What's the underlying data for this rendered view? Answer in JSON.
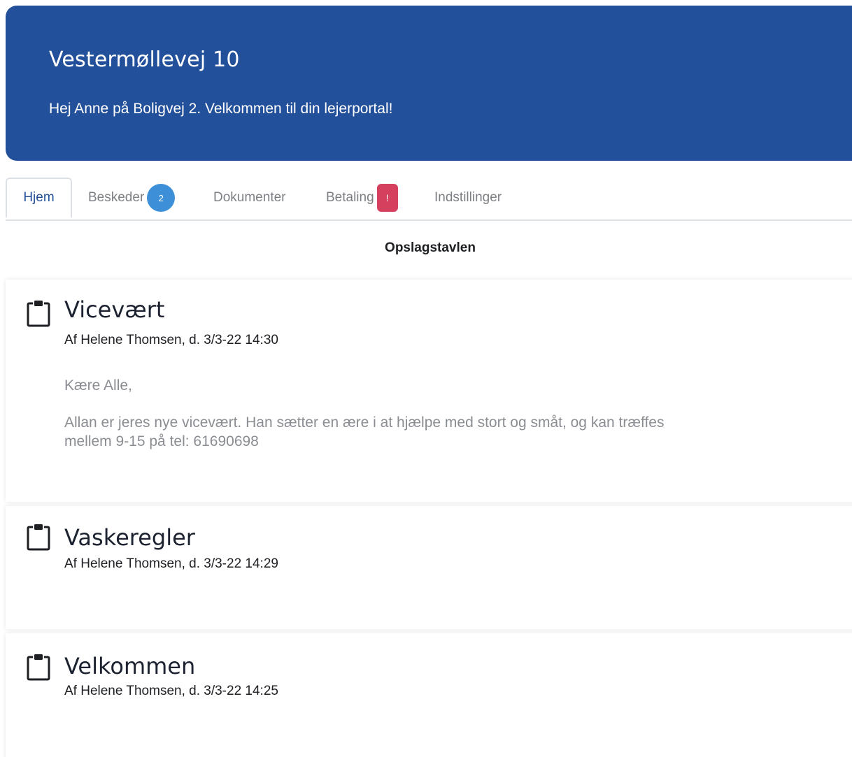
{
  "header": {
    "title": "Vestermøllevej 10",
    "subtitle": "Hej Anne på Boligvej 2. Velkommen til din lejerportal!"
  },
  "tabs": [
    {
      "label": "Hjem",
      "active": true
    },
    {
      "label": "Beskeder",
      "badge": "2"
    },
    {
      "label": "Dokumenter"
    },
    {
      "label": "Betaling",
      "badge": "!"
    },
    {
      "label": "Indstillinger"
    }
  ],
  "board": {
    "title": "Opslagstavlen"
  },
  "posts": [
    {
      "icon": "clipboard-icon",
      "title": "Vicevært",
      "meta": "Af Helene Thomsen, d. 3/3-22 14:30",
      "body": [
        "Kære Alle,",
        "Allan er jeres nye vicevært. Han sætter en ære i at hjælpe med stort og småt, og kan træffes mellem 9-15 på tel: 61690698"
      ]
    },
    {
      "icon": "clipboard-icon",
      "title": "Vaskeregler",
      "meta": "Af Helene Thomsen, d. 3/3-22 14:29"
    },
    {
      "icon": "clipboard-icon",
      "title": "Velkommen",
      "meta": "Af Helene Thomsen, d. 3/3-22 14:25"
    }
  ],
  "colors": {
    "header_bg": "#23509a",
    "active_tab": "#23509a",
    "badge_count": "#3d8fd8",
    "badge_alert": "#d6405f"
  }
}
